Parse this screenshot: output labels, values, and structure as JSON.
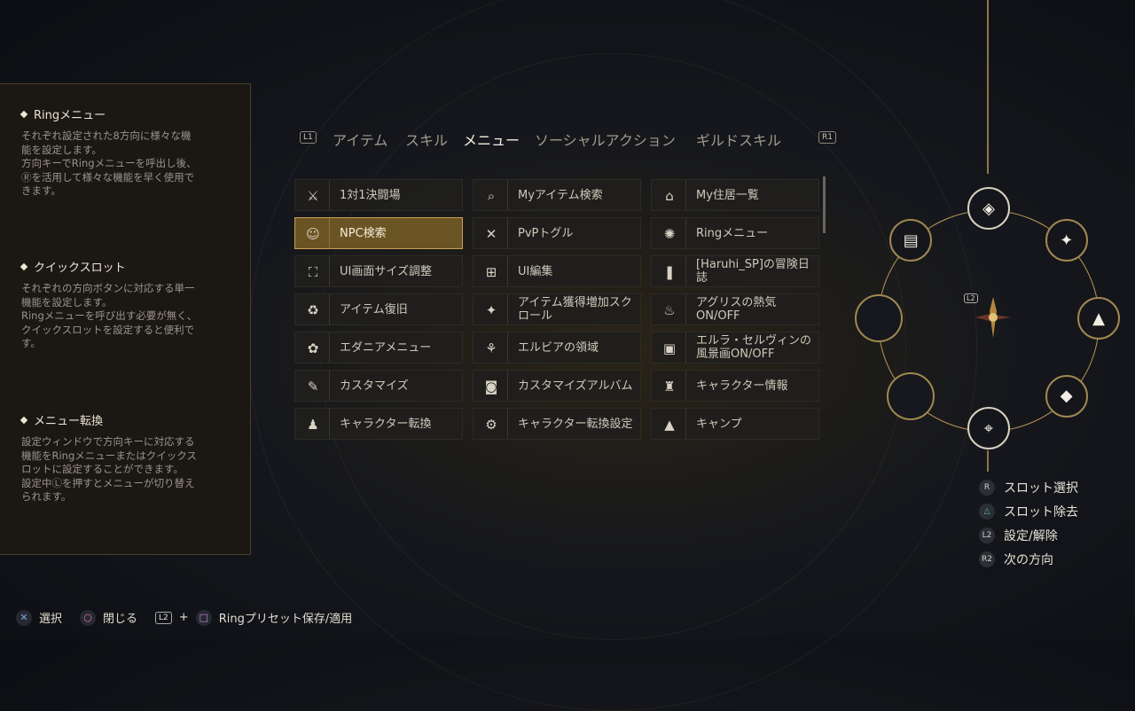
{
  "help": {
    "sections": [
      {
        "title": "Ringメニュー",
        "body": "それぞれ設定された8方向に様々な機\n能を設定します。\n方向キーでRingメニューを呼出し後、\nⓇを活用して様々な機能を早く使用で\nきます。"
      },
      {
        "title": "クイックスロット",
        "body": "それぞれの方向ボタンに対応する単一\n機能を設定します。\nRingメニューを呼び出す必要が無く、\nクイックスロットを設定すると便利で\nす。"
      },
      {
        "title": "メニュー転換",
        "body": "設定ウィンドウで方向キーに対応する\n機能をRingメニューまたはクイックス\nロットに設定することができます。\n設定中Ⓛを押すとメニューが切り替え\nられます。"
      }
    ]
  },
  "tabs": {
    "left_btn": "L1",
    "right_btn": "R1",
    "items": [
      "アイテム",
      "スキル",
      "メニュー",
      "ソーシャルアクション",
      "ギルドスキル"
    ],
    "active": "メニュー"
  },
  "grid": {
    "items": [
      {
        "label": "1対1決闘場",
        "icon": "crossed-swords-icon",
        "glyph": "⚔"
      },
      {
        "label": "Myアイテム検索",
        "icon": "bag-search-icon",
        "glyph": "⌕"
      },
      {
        "label": "My住居一覧",
        "icon": "house-icon",
        "glyph": "⌂"
      },
      {
        "label": "NPC検索",
        "icon": "npc-search-icon",
        "glyph": "☺"
      },
      {
        "label": "PvPトグル",
        "icon": "pvp-swords-icon",
        "glyph": "✕"
      },
      {
        "label": "Ringメニュー",
        "icon": "ring-menu-icon",
        "glyph": "✺"
      },
      {
        "label": "UI画面サイズ調整",
        "icon": "ui-resize-icon",
        "glyph": "⛶"
      },
      {
        "label": "UI編集",
        "icon": "ui-edit-icon",
        "glyph": "⊞"
      },
      {
        "label": "[Haruhi_SP]の冒険日誌",
        "icon": "journal-icon",
        "glyph": "❚"
      },
      {
        "label": "アイテム復旧",
        "icon": "item-restore-icon",
        "glyph": "♻"
      },
      {
        "label": "アイテム獲得増加スクロール",
        "icon": "scroll-boost-icon",
        "glyph": "✦"
      },
      {
        "label": "アグリスの熱気ON/OFF",
        "icon": "heat-toggle-icon",
        "glyph": "♨"
      },
      {
        "label": "エダニアメニュー",
        "icon": "edania-icon",
        "glyph": "✿"
      },
      {
        "label": "エルビアの領域",
        "icon": "elvia-icon",
        "glyph": "⚘"
      },
      {
        "label": "エルラ・セルヴィンの風景画ON/OFF",
        "icon": "landscape-icon",
        "glyph": "▣"
      },
      {
        "label": "カスタマイズ",
        "icon": "customize-icon",
        "glyph": "✎"
      },
      {
        "label": "カスタマイズアルバム",
        "icon": "camera-icon",
        "glyph": "◙"
      },
      {
        "label": "キャラクター情報",
        "icon": "helmet-icon",
        "glyph": "♜"
      },
      {
        "label": "キャラクター転換",
        "icon": "character-switch-icon",
        "glyph": "♟"
      },
      {
        "label": "キャラクター転換設定",
        "icon": "character-settings-icon",
        "glyph": "⚙"
      },
      {
        "label": "キャンプ",
        "icon": "camp-icon",
        "glyph": "▲"
      }
    ],
    "selected_index": 3
  },
  "ring": {
    "center_badge": "L2",
    "slots": [
      {
        "pos": "top",
        "icon": "ring-diamond-icon",
        "glyph": "◈"
      },
      {
        "pos": "top-right",
        "icon": "scroll-boost-icon",
        "glyph": "✦"
      },
      {
        "pos": "right",
        "icon": "camp-icon",
        "glyph": "▲"
      },
      {
        "pos": "bottom-right",
        "icon": "gem-icon",
        "glyph": "◆"
      },
      {
        "pos": "bottom",
        "icon": "telescope-icon",
        "glyph": "⌖"
      },
      {
        "pos": "bottom-left",
        "icon": "empty-slot",
        "glyph": ""
      },
      {
        "pos": "left",
        "icon": "empty-slot",
        "glyph": ""
      },
      {
        "pos": "top-left",
        "icon": "chest-icon",
        "glyph": "▤"
      }
    ]
  },
  "legend": [
    {
      "btn": "R",
      "label": "スロット選択"
    },
    {
      "btn": "△",
      "label": "スロット除去"
    },
    {
      "btn": "L2",
      "label": "設定/解除"
    },
    {
      "btn": "R2",
      "label": "次の方向"
    }
  ],
  "bottom": {
    "select_btn": "✕",
    "select_label": "選択",
    "close_btn": "○",
    "close_label": "閉じる",
    "combo_btn1": "L2",
    "combo_plus": "+",
    "combo_btn2": "□",
    "combo_label": "Ringプリセット保存/適用"
  },
  "colors": {
    "accent": "#c7a155",
    "selected_bg": "#6b5424",
    "panel_bg": "#1c1812"
  }
}
